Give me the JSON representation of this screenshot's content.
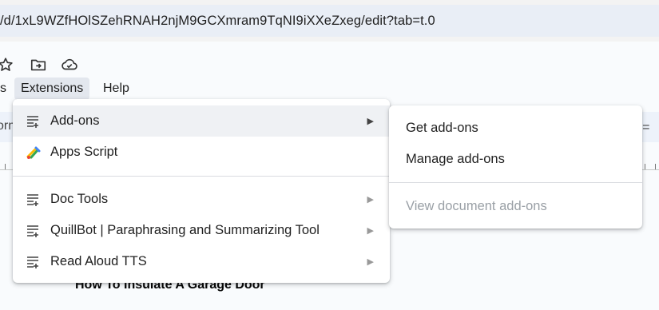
{
  "browser": {
    "url": "/d/1xL9WZfHOlSZehRNAH2njM9GCXmram9TqNI9iXXeZxeg/edit?tab=t.0"
  },
  "doc_icons": [
    "star-icon",
    "move-to-folder-icon",
    "cloud-saved-icon"
  ],
  "menubar": {
    "prev_fragment": "s",
    "extensions": "Extensions",
    "help": "Help"
  },
  "toolbar": {
    "fragment": "orm",
    "list_glyph": "⁝="
  },
  "document": {
    "heading": "How To Insulate A Garage Door"
  },
  "extensions_menu": {
    "items": [
      {
        "label": "Add-ons",
        "icon": "add-ons-icon",
        "has_submenu": true
      },
      {
        "label": "Apps Script",
        "icon": "apps-script-icon",
        "has_submenu": false
      },
      {
        "label": "Doc Tools",
        "icon": "add-on-list-icon",
        "has_submenu": true
      },
      {
        "label": "QuillBot | Paraphrasing and Summarizing Tool",
        "icon": "add-on-list-icon",
        "has_submenu": true
      },
      {
        "label": "Read Aloud TTS",
        "icon": "add-on-list-icon",
        "has_submenu": true
      }
    ],
    "submenu_arrow": "▶"
  },
  "addons_submenu": {
    "get": "Get add-ons",
    "manage": "Manage add-ons",
    "view_document": "View document add-ons"
  },
  "colors": {
    "urlbar_bg": "#e9eef6",
    "highlight": "#eff1f4",
    "disabled_text": "#9aa0a6"
  }
}
